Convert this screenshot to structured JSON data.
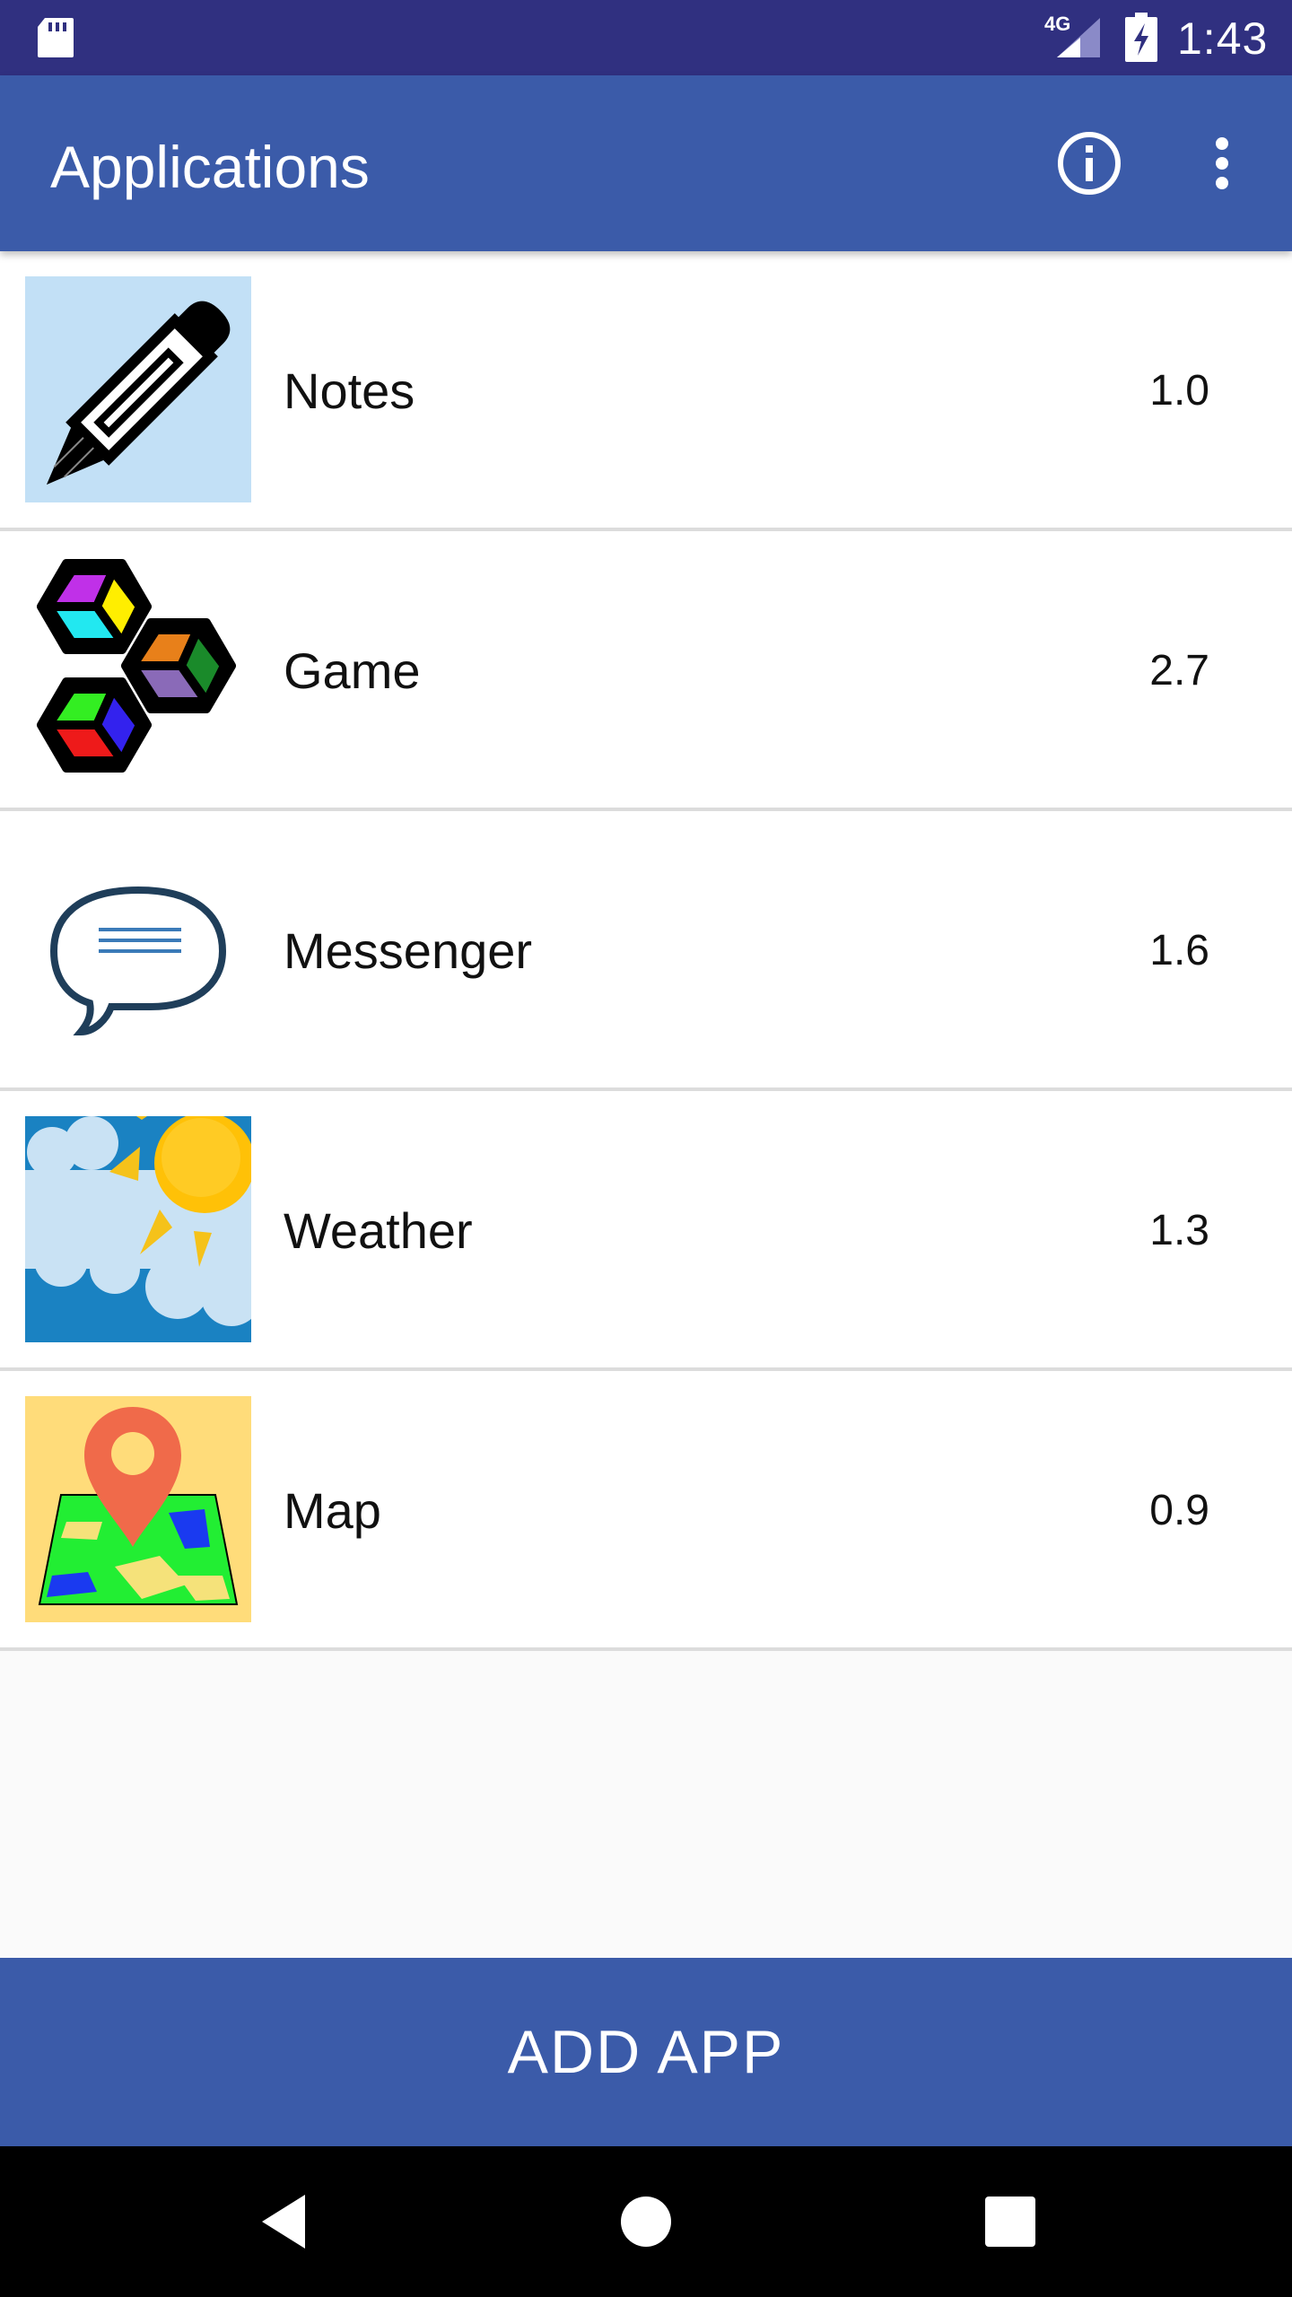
{
  "status_bar": {
    "network_type": "4G",
    "time": "1:43",
    "icons": [
      "sd-card-icon",
      "signal-icon",
      "battery-charging-icon"
    ]
  },
  "app_bar": {
    "title": "Applications",
    "icons": [
      "info-icon",
      "more-vert-icon"
    ]
  },
  "apps": [
    {
      "name": "Notes",
      "version": "1.0",
      "icon": "pencil-icon"
    },
    {
      "name": "Game",
      "version": "2.7",
      "icon": "cubes-icon"
    },
    {
      "name": "Messenger",
      "version": "1.6",
      "icon": "speech-bubble-icon"
    },
    {
      "name": "Weather",
      "version": "1.3",
      "icon": "sun-cloud-icon"
    },
    {
      "name": "Map",
      "version": "0.9",
      "icon": "map-pin-icon"
    }
  ],
  "add_button": {
    "label": "ADD APP"
  },
  "nav_bar": {
    "icons": [
      "back-icon",
      "home-icon",
      "recents-icon"
    ]
  },
  "colors": {
    "status_bar": "#303080",
    "primary": "#3b5ba9",
    "background": "#fafafa",
    "divider": "#dcdcdc"
  }
}
